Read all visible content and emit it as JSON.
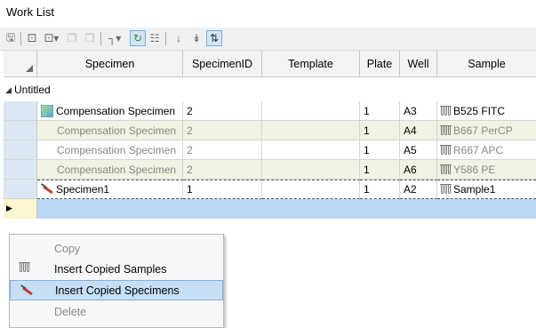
{
  "window": {
    "title": "Work List"
  },
  "toolbar": {
    "buttons": [
      "save-icon",
      "new-sample-icon",
      "new-sample-dropdown-icon",
      "copy-icon",
      "paste-icon",
      "move-icon",
      "move-dropdown-icon",
      "refresh-icon",
      "grid-icon",
      "down-icon",
      "down-all-icon",
      "sort-icon"
    ]
  },
  "grid": {
    "columns": [
      "Specimen",
      "SpecimenID",
      "Template",
      "Plate",
      "Well",
      "Sample"
    ],
    "group_label": "Untitled",
    "rows": [
      {
        "specimen": "Compensation Specimen",
        "specimen_id": "2",
        "template": "",
        "plate": "1",
        "well": "A3",
        "sample": "B525 FITC",
        "icon": "compensation-specimen-icon"
      },
      {
        "specimen": "Compensation Specimen",
        "specimen_id": "2",
        "template": "",
        "plate": "1",
        "well": "A4",
        "sample": "B667 PerCP",
        "icon": ""
      },
      {
        "specimen": "Compensation Specimen",
        "specimen_id": "2",
        "template": "",
        "plate": "1",
        "well": "A5",
        "sample": "R667 APC",
        "icon": ""
      },
      {
        "specimen": "Compensation Specimen",
        "specimen_id": "2",
        "template": "",
        "plate": "1",
        "well": "A6",
        "sample": "Y586 PE",
        "icon": ""
      },
      {
        "specimen": "Specimen1",
        "specimen_id": "1",
        "template": "",
        "plate": "1",
        "well": "A2",
        "sample": "Sample1",
        "icon": "specimen-icon"
      }
    ]
  },
  "context_menu": {
    "items": [
      {
        "label": "Copy",
        "enabled": false,
        "icon": ""
      },
      {
        "label": "Insert Copied Samples",
        "enabled": true,
        "icon": "tubes-icon"
      },
      {
        "label": "Insert Copied Specimens",
        "enabled": true,
        "icon": "specimen-icon",
        "highlighted": true
      },
      {
        "label": "Delete",
        "enabled": false,
        "icon": ""
      }
    ]
  }
}
